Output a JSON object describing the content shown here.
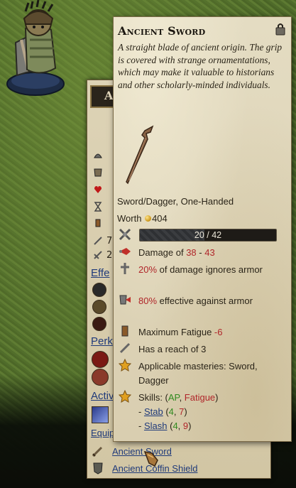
{
  "tooltip": {
    "title": "Ancient Sword",
    "description": "A straight blade of ancient origin. The grip is covered with strange ornamentations, which may make it valuable to historians and other scholarly-minded individuals.",
    "type_line": "Sword/Dagger, One-Handed",
    "worth_label": "Worth",
    "worth_value": "404",
    "durability": {
      "current": 20,
      "max": 42,
      "text": "20 / 42"
    },
    "damage": {
      "label": "Damage of ",
      "min": "38",
      "sep": " - ",
      "max": "43"
    },
    "ignore_armor": {
      "value": "20%",
      "text": " of damage ignores armor"
    },
    "armor_effective": {
      "value": "80%",
      "text": " effective against armor"
    },
    "fatigue": {
      "label": "Maximum Fatigue ",
      "value": "-6"
    },
    "reach": "Has a reach of 3",
    "masteries": "Applicable masteries: Sword, Dagger",
    "skills": {
      "label": "Skills: (",
      "ap": "AP",
      "comma": ", ",
      "fatigue": "Fatigue",
      "close": ")",
      "list": [
        {
          "name": "Stab",
          "ap": "4",
          "fatigue": "7"
        },
        {
          "name": "Slash",
          "ap": "4",
          "fatigue": "9"
        }
      ]
    }
  },
  "panel": {
    "tab_letter": "A",
    "stat_1": "7",
    "stat_2": "2",
    "effects_label": "Effe",
    "perks_label": "Perk",
    "active_label": "Activ",
    "equipped_label": "Equipped Items",
    "equipped_items": [
      "Ancient Sword",
      "Ancient Coffin Shield"
    ]
  },
  "colors": {
    "red": "#b0262a",
    "green": "#2f8a1e",
    "link": "#1f3a7a",
    "parchment": "#ddd3b6"
  }
}
